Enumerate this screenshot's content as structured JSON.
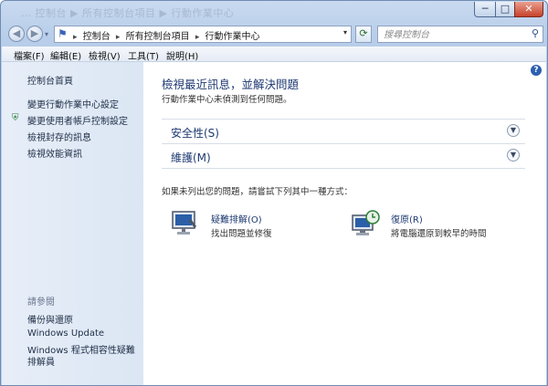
{
  "window": {
    "title": "… 控制台 ▶ 所有控制台項目 ▶ 行動作業中心",
    "minimize": "─",
    "maximize": "□",
    "close": "✕"
  },
  "nav": {
    "back": "◀",
    "forward": "▶",
    "recent": "▾",
    "breadcrumbs": [
      "控制台",
      "所有控制台項目",
      "行動作業中心"
    ],
    "separator": "▸",
    "address_dropdown": "▾",
    "refresh": "⟳",
    "search_placeholder": "搜尋控制台"
  },
  "menu": [
    "檔案(F)",
    "編輯(E)",
    "檢視(V)",
    "工具(T)",
    "說明(H)"
  ],
  "sidebar": {
    "home": "控制台首頁",
    "links": [
      "變更行動作業中心設定",
      "變更使用者帳戶控制設定",
      "檢視封存的訊息",
      "檢視效能資訊"
    ],
    "see_also_label": "請參閱",
    "see_also": [
      "備份與還原",
      "Windows Update",
      "Windows 程式相容性疑難排解員"
    ]
  },
  "main": {
    "title": "檢視最近訊息，並解決問題",
    "subtitle": "行動作業中心未偵測到任何問題。",
    "sections": [
      "安全性(S)",
      "維護(M)"
    ],
    "hint": "如果未列出您的問題，請嘗試下列其中一種方式：",
    "tools": [
      {
        "label": "疑難排解(O)",
        "desc": "找出問題並修復"
      },
      {
        "label": "復原(R)",
        "desc": "將電腦還原到較早的時間"
      }
    ],
    "help": "?"
  },
  "icons": {
    "flag": "flag-icon",
    "search": "search-icon",
    "shield": "shield-icon",
    "chevron": "chevron-down-icon",
    "help": "help-icon",
    "troubleshoot": "troubleshoot-icon",
    "recovery": "recovery-icon"
  },
  "colors": {
    "link": "#1e3a72",
    "sidebar_bg": "#dbe6f4",
    "frame": "#b7cde9"
  }
}
